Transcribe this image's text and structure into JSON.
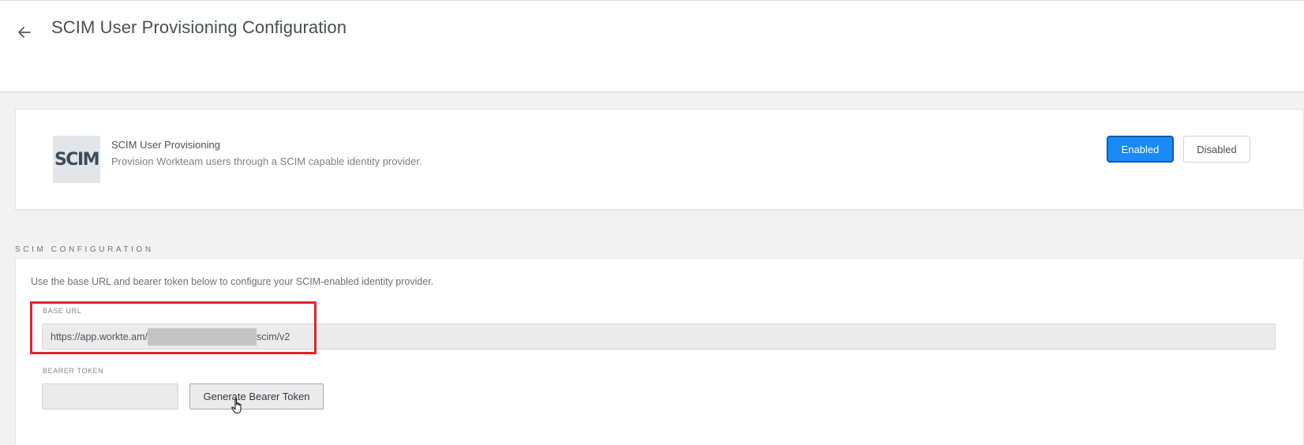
{
  "header": {
    "title": "SCIM User Provisioning Configuration",
    "back_icon": "arrow-left-icon"
  },
  "integration": {
    "logo_text": "SCIM",
    "title": "SCIM User Provisioning",
    "description": "Provision Workteam users through a SCIM capable identity provider.",
    "status_selected": "Enabled",
    "buttons": {
      "enabled": "Enabled",
      "disabled": "Disabled"
    }
  },
  "config": {
    "section_heading": "SCIM CONFIGURATION",
    "intro": "Use the base URL and bearer token below to configure your SCIM-enabled identity provider.",
    "base_url": {
      "label": "BASE URL",
      "value_prefix": "https://app.workte.am/",
      "value_suffix": "scim/v2"
    },
    "bearer_token": {
      "label": "BEARER TOKEN",
      "value": "",
      "generate_label": "Generate Bearer Token"
    }
  },
  "colors": {
    "accent": "#1a8af7",
    "highlight": "#e0242d",
    "background": "#f2f2f3"
  }
}
